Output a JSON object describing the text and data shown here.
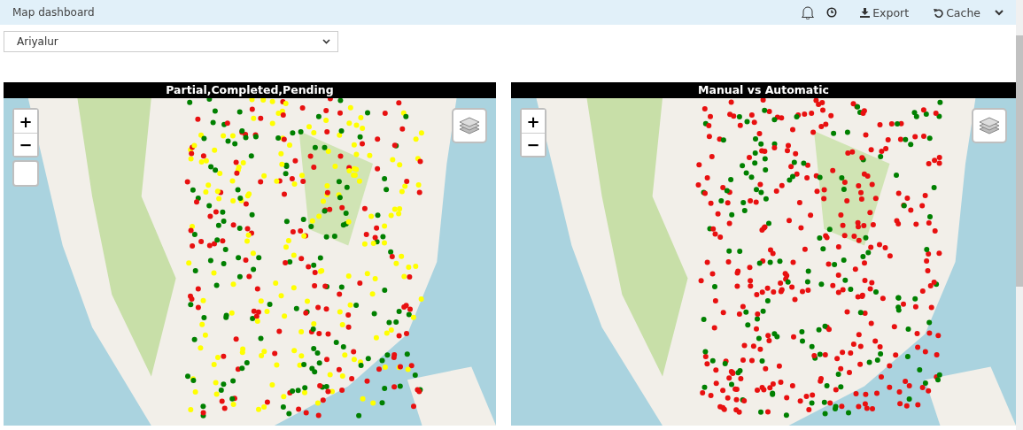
{
  "header": {
    "title": "Map dashboard",
    "actions": [
      {
        "kind": "bell"
      },
      {
        "kind": "clock"
      },
      {
        "kind": "export",
        "label": "Export"
      },
      {
        "kind": "cache",
        "label": "Cache"
      },
      {
        "kind": "chevron"
      }
    ]
  },
  "district_select": {
    "value": "Ariyalur"
  },
  "maps": [
    {
      "title": "Partial,Completed,Pending",
      "zoom_in": "+",
      "zoom_out": "−",
      "blank_control": true,
      "kind": "status"
    },
    {
      "title": "Manual vs Automatic",
      "zoom_in": "+",
      "zoom_out": "−",
      "blank_control": false,
      "kind": "method"
    }
  ]
}
